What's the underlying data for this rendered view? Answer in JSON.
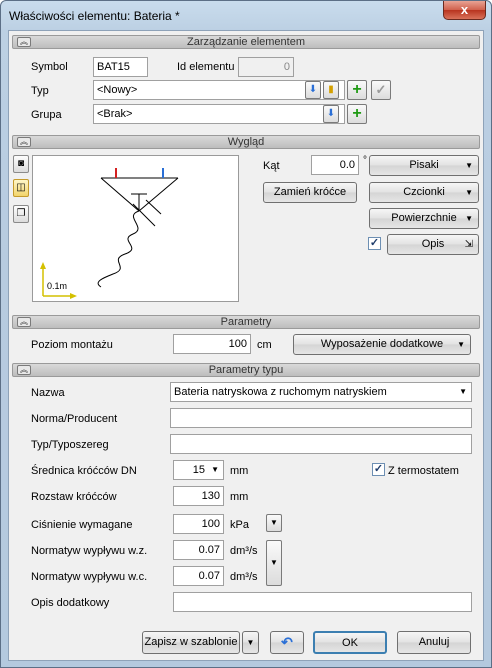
{
  "window": {
    "title": "Właściwości elementu: Bateria *",
    "close_glyph": "x"
  },
  "element_management": {
    "section_title": "Zarządzanie elementem",
    "symbol_label": "Symbol",
    "symbol_value": "BAT15",
    "id_label": "Id elementu",
    "id_value": "0",
    "typ_label": "Typ",
    "typ_value": "<Nowy>",
    "grupa_label": "Grupa",
    "grupa_value": "<Brak>"
  },
  "appearance": {
    "section_title": "Wygląd",
    "angle_label": "Kąt",
    "angle_value": "0.0",
    "angle_unit": "°",
    "pisaki_label": "Pisaki",
    "zamien_label": "Zamień króćce",
    "czcionki_label": "Czcionki",
    "powierzchnie_label": "Powierzchnie",
    "opis_label": "Opis",
    "opis_checked": true,
    "scale_label": "0.1m",
    "colors": {
      "red": "#d42020",
      "blue": "#2a6fd6",
      "axis": "#d4c000"
    }
  },
  "parameters": {
    "section_title": "Parametry",
    "poziom_label": "Poziom montażu",
    "poziom_value": "100",
    "poziom_unit": "cm",
    "wyposazenie_label": "Wyposażenie dodatkowe"
  },
  "type_parameters": {
    "section_title": "Parametry typu",
    "nazwa_label": "Nazwa",
    "nazwa_value": "Bateria natryskowa z ruchomym natryskiem",
    "norma_label": "Norma/Producent",
    "norma_value": "",
    "typoszereg_label": "Typ/Typoszereg",
    "typoszereg_value": "",
    "srednica_label": "Średnica króćców DN",
    "srednica_value": "15",
    "srednica_unit": "mm",
    "termostat_label": "Z termostatem",
    "termostat_checked": true,
    "rozstaw_label": "Rozstaw króćców",
    "rozstaw_value": "130",
    "rozstaw_unit": "mm",
    "cisnienie_label": "Ciśnienie wymagane",
    "cisnienie_value": "100",
    "cisnienie_unit": "kPa",
    "wyplyw_wz_label": "Normatyw wypływu w.z.",
    "wyplyw_wz_value": "0.07",
    "wyplyw_wz_unit": "dm³/s",
    "wyplyw_wc_label": "Normatyw wypływu w.c.",
    "wyplyw_wc_value": "0.07",
    "wyplyw_wc_unit": "dm³/s",
    "opis_dod_label": "Opis dodatkowy",
    "opis_dod_value": ""
  },
  "footer": {
    "zapisz_label": "Zapisz w szablonie",
    "ok_label": "OK",
    "anuluj_label": "Anuluj"
  }
}
